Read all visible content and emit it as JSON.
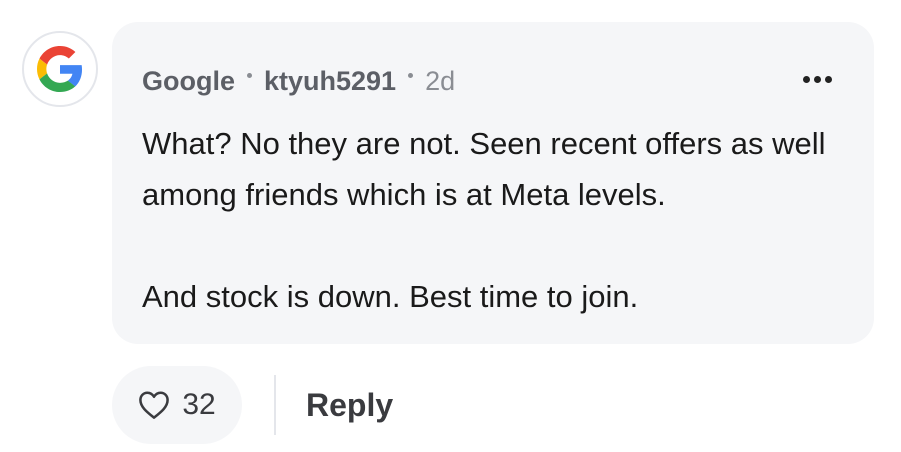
{
  "comment": {
    "company": "Google",
    "username": "ktyuh5291",
    "time_ago": "2d",
    "paragraphs": [
      "What? No they are not. Seen recent offers as well among friends which is at Meta levels.",
      "And stock is down. Best time to join."
    ]
  },
  "actions": {
    "like_count": "32",
    "reply_label": "Reply"
  },
  "icons": {
    "avatar": "google-logo-icon",
    "more": "more-options-icon",
    "like": "heart-outline-icon"
  },
  "colors": {
    "bubble_bg": "#f5f6f8",
    "google_blue": "#4285F4",
    "google_red": "#EA4335",
    "google_yellow": "#FBBC05",
    "google_green": "#34A853"
  }
}
